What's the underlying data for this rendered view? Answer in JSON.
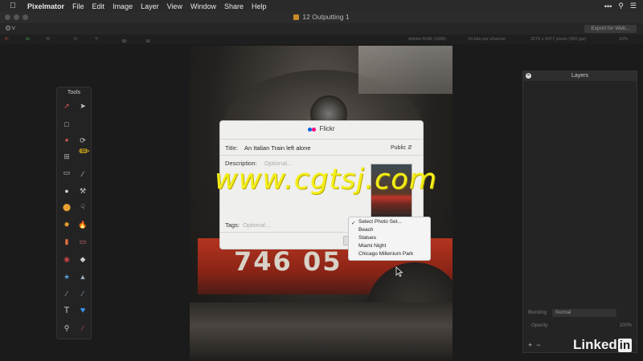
{
  "menubar": {
    "app": "Pixelmator",
    "items": [
      "File",
      "Edit",
      "Image",
      "Layer",
      "View",
      "Window",
      "Share",
      "Help"
    ]
  },
  "window": {
    "title": "12 Outputting 1"
  },
  "toolbar": {
    "export_label": "Export for Web..."
  },
  "infobar": {
    "w_label": "W:",
    "w_value": "0",
    "h_label": "H:",
    "h_value": "0",
    "color_profile": "Adobe RGB (1998)",
    "bit_depth": "16-bits per channel",
    "dimensions": "3275 x 4377 pixels (300 ppi)",
    "zoom": "16%"
  },
  "tools_panel": {
    "title": "Tools"
  },
  "layers_panel": {
    "title": "Layers",
    "blending_label": "Blending",
    "blending_value": "Normal",
    "opacity_label": "Opacity",
    "opacity_value": "100%"
  },
  "flickr_dialog": {
    "title": "Flickr",
    "title_label": "Title:",
    "title_value": "An Italian Train left alone",
    "privacy_value": "Public",
    "description_label": "Description:",
    "description_placeholder": "Optional...",
    "tags_label": "Tags:",
    "tags_placeholder": "Optional...",
    "photoset_options": [
      "Select Photo Set...",
      "Beach",
      "Statues",
      "Miami Night",
      "Chicago Millenium Park"
    ],
    "photoset_selected": "Select Photo Set..."
  },
  "watermark": {
    "text": "www.cgtsj.com"
  },
  "brand": {
    "linkedin_text": "Linked",
    "linkedin_box": "in"
  },
  "colors": {
    "watermark": "#f4ef1a",
    "flickr_blue": "#0063dc",
    "flickr_pink": "#ff0084"
  }
}
